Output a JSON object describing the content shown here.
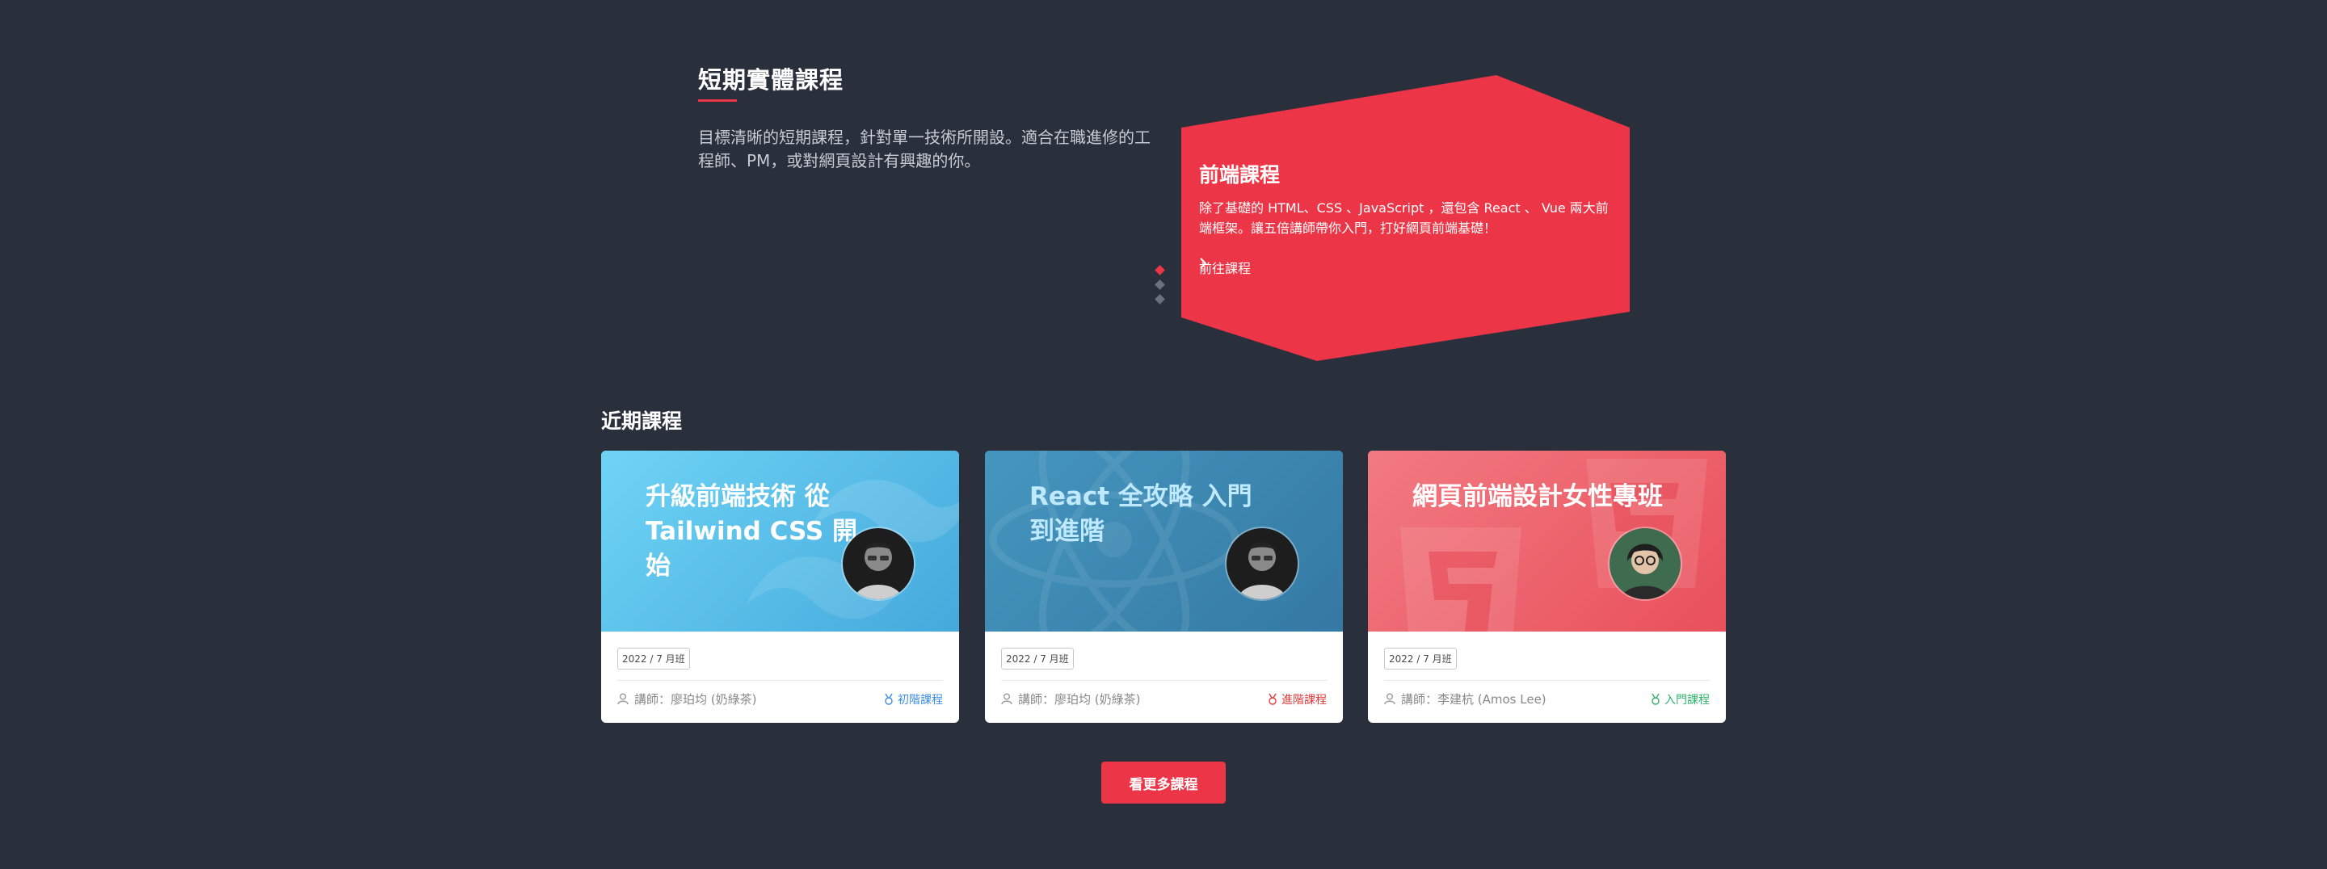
{
  "short_course": {
    "title": "短期實體課程",
    "description": "目標清晰的短期課程，針對單一技術所開設。適合在職進修的工程師、PM，或對網頁設計有興趣的你。",
    "carousel_count": 3,
    "carousel_active": 1,
    "feature": {
      "title": "前端課程",
      "description": "除了基礎的 HTML、CSS 、JavaScript ，還包含 React 、 Vue 兩大前端框架。讓五倍講師帶你入門，打好網頁前端基礎！",
      "link_label": "前往課程",
      "link_icon": "chevron-right-icon",
      "color": "#ec3546"
    }
  },
  "recent": {
    "title": "近期課程",
    "cards": [
      {
        "banner_title": "升級前端技術 從 Tailwind CSS 開始",
        "banner_color": "#58c1ea",
        "cohort": "2022 / 7 月班",
        "teacher": "講師：廖珀均 (奶綠茶)",
        "level": "初階課程",
        "level_color": "#3c8ee6",
        "level_icon": "medal-icon"
      },
      {
        "banner_title": "React 全攻略 入門到進階",
        "banner_color": "#3d8ab1",
        "cohort": "2022 / 7 月班",
        "teacher": "講師：廖珀均 (奶綠茶)",
        "level": "進階課程",
        "level_color": "#e23a3a",
        "level_icon": "medal-icon"
      },
      {
        "banner_title": "網頁前端設計女性專班",
        "banner_color": "#ee5c66",
        "cohort": "2022 / 7 月班",
        "teacher": "講師：李建杭 (Amos Lee)",
        "level": "入門課程",
        "level_color": "#2eb36b",
        "level_icon": "medal-icon"
      }
    ]
  },
  "more_button": "看更多課程",
  "colors": {
    "background": "#2a2f3c",
    "accent": "#ec3546"
  }
}
